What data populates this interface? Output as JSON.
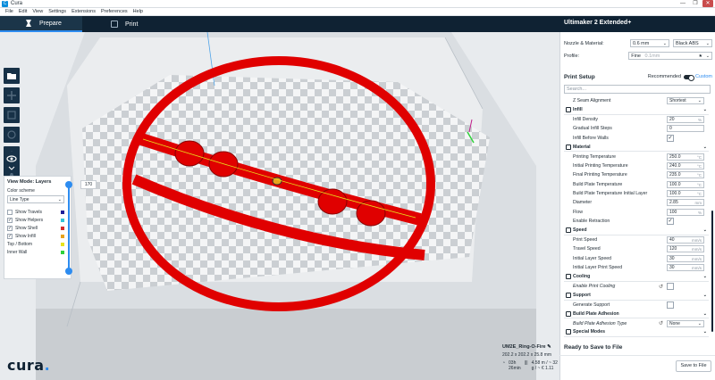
{
  "window": {
    "app_icon": "C",
    "title": "Cura",
    "min": "—",
    "max": "❐",
    "close": "✕"
  },
  "menu": [
    "File",
    "Edit",
    "View",
    "Settings",
    "Extensions",
    "Preferences",
    "Help"
  ],
  "header": {
    "prepare": "Prepare",
    "print": "Print",
    "machine": "Ultimaker 2 Extended+"
  },
  "view_panel": {
    "title": "View Mode: Layers",
    "color_scheme_label": "Color scheme",
    "color_scheme_value": "Line Type",
    "rows": [
      {
        "label": "Show Travels",
        "checked": false,
        "color": "#1f1f9a"
      },
      {
        "label": "Show Helpers",
        "checked": true,
        "color": "#33c4d8"
      },
      {
        "label": "Show Shell",
        "checked": true,
        "color": "#d42a2a"
      },
      {
        "label": "Show Infill",
        "checked": true,
        "color": "#e8a21c"
      },
      {
        "label": "Top / Bottom",
        "checked": null,
        "color": "#e8e31c"
      },
      {
        "label": "Inner Wall",
        "checked": null,
        "color": "#2fd13b"
      }
    ],
    "layer_number": "170"
  },
  "object": {
    "name": "UM2E_Ring-O-Fire",
    "dims": "202.2 x 202.2 x 25.8 mm",
    "time": "03h 26min",
    "material": "4.58 m / ~ 32 g / ~ € 1.11"
  },
  "logo": {
    "text": "cura",
    "dot": "."
  },
  "right_panel": {
    "nozzle_label": "Nozzle & Material:",
    "nozzle_value": "0.6 mm",
    "material_value": "Black ABS",
    "profile_label": "Profile:",
    "profile_value": "Fine",
    "profile_hint": "0.1mm",
    "print_setup": "Print Setup",
    "recommended": "Recommended",
    "custom": "Custom",
    "search_placeholder": "Search...",
    "settings": [
      {
        "type": "dd",
        "label": "Z Seam Alignment",
        "value": "Shortest"
      },
      {
        "type": "cat",
        "label": "Infill"
      },
      {
        "type": "val",
        "label": "Infill Density",
        "value": "20",
        "unit": "%"
      },
      {
        "type": "val",
        "label": "Gradual Infill Steps",
        "value": "0",
        "unit": ""
      },
      {
        "type": "chk",
        "label": "Infill Before Walls",
        "value": "✓"
      },
      {
        "type": "cat",
        "label": "Material"
      },
      {
        "type": "val",
        "label": "Printing Temperature",
        "value": "250.0",
        "unit": "°C"
      },
      {
        "type": "val",
        "label": "Initial Printing Temperature",
        "value": "240.0",
        "unit": "°C"
      },
      {
        "type": "val",
        "label": "Final Printing Temperature",
        "value": "235.0",
        "unit": "°C"
      },
      {
        "type": "val",
        "label": "Build Plate Temperature",
        "value": "100.0",
        "unit": "°C"
      },
      {
        "type": "val",
        "label": "Build Plate Temperature Initial Layer",
        "value": "100.0",
        "unit": "°C"
      },
      {
        "type": "val",
        "label": "Diameter",
        "value": "2.85",
        "unit": "mm"
      },
      {
        "type": "val",
        "label": "Flow",
        "value": "100",
        "unit": "%"
      },
      {
        "type": "chk",
        "label": "Enable Retraction",
        "value": "✓"
      },
      {
        "type": "cat",
        "label": "Speed"
      },
      {
        "type": "val",
        "label": "Print Speed",
        "value": "40",
        "unit": "mm/s"
      },
      {
        "type": "val",
        "label": "Travel Speed",
        "value": "120",
        "unit": "mm/s"
      },
      {
        "type": "val",
        "label": "Initial Layer Speed",
        "value": "30",
        "unit": "mm/s"
      },
      {
        "type": "val",
        "label": "Initial Layer Print Speed",
        "value": "30",
        "unit": "mm/s"
      },
      {
        "type": "cat",
        "label": "Cooling"
      },
      {
        "type": "chk",
        "label": "Enable Print Cooling",
        "value": "",
        "italic": true,
        "reset": "↺"
      },
      {
        "type": "cat",
        "label": "Support"
      },
      {
        "type": "chk",
        "label": "Generate Support",
        "value": ""
      },
      {
        "type": "cat",
        "label": "Build Plate Adhesion"
      },
      {
        "type": "dd",
        "label": "Build Plate Adhesion Type",
        "value": "None",
        "italic": true,
        "reset": "↺"
      },
      {
        "type": "cat",
        "label": "Special Modes"
      }
    ],
    "ready": "Ready to Save to File",
    "save": "Save to File"
  }
}
